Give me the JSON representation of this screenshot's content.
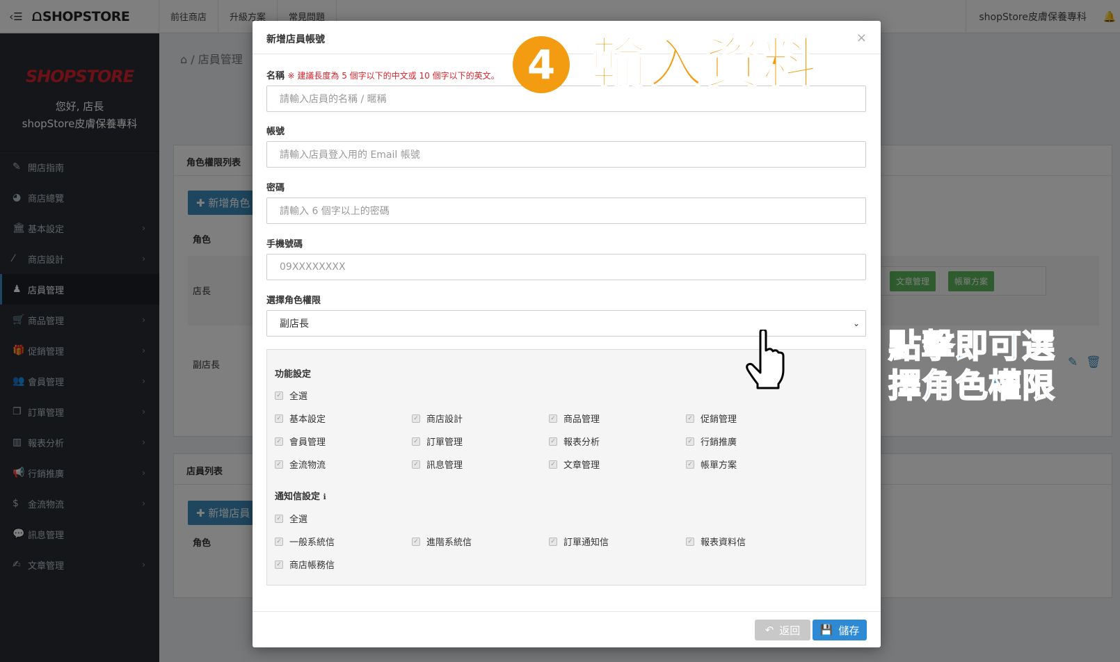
{
  "topbar": {
    "brand": "SHOPSTORE",
    "nav": [
      "前往商店",
      "升級方案",
      "常見問題"
    ],
    "store_name": "shopStore皮膚保養專科"
  },
  "sidebar": {
    "logo": "SHOPSTORE",
    "greeting": "您好, 店長",
    "store_name": "shopStore皮膚保養專科",
    "items": [
      {
        "label": "開店指南",
        "icon": "wrench-icon",
        "chevron": false
      },
      {
        "label": "商店總覽",
        "icon": "dashboard-icon",
        "chevron": false
      },
      {
        "label": "基本設定",
        "icon": "bank-icon",
        "chevron": true
      },
      {
        "label": "商店設計",
        "icon": "wand-icon",
        "chevron": true
      },
      {
        "label": "店員管理",
        "icon": "user-lock-icon",
        "chevron": false,
        "active": true
      },
      {
        "label": "商品管理",
        "icon": "cart-icon",
        "chevron": true
      },
      {
        "label": "促銷管理",
        "icon": "gift-icon",
        "chevron": true
      },
      {
        "label": "會員管理",
        "icon": "users-icon",
        "chevron": true
      },
      {
        "label": "訂單管理",
        "icon": "copy-icon",
        "chevron": true
      },
      {
        "label": "報表分析",
        "icon": "bar-chart-icon",
        "chevron": true
      },
      {
        "label": "行銷推廣",
        "icon": "bullhorn-icon",
        "chevron": true
      },
      {
        "label": "金流物流",
        "icon": "dollar-icon",
        "chevron": true
      },
      {
        "label": "訊息管理",
        "icon": "comments-icon",
        "chevron": false
      },
      {
        "label": "文章管理",
        "icon": "edit-icon",
        "chevron": true
      }
    ]
  },
  "background": {
    "breadcrumb": "店員管理",
    "roles_panel_title": "角色權限列表",
    "add_role_button": "新增角色",
    "role_col": "角色",
    "role_rows": [
      "店長",
      "副店長"
    ],
    "tags": [
      "文章管理",
      "帳單方案"
    ],
    "staff_panel_title": "店員列表",
    "add_staff_button": "新增店員",
    "staff_role_col": "角色"
  },
  "modal": {
    "title": "新增店員帳號",
    "close": "×",
    "name_label": "名稱",
    "name_hint": "※ 建議長度為 5 個字以下的中文或 10 個字以下的英文。",
    "name_placeholder": "請輸入店員的名稱 / 暱稱",
    "account_label": "帳號",
    "account_placeholder": "請輸入店員登入用的 Email 帳號",
    "password_label": "密碼",
    "password_placeholder": "請輸入 6 個字以上的密碼",
    "phone_label": "手機號碼",
    "phone_placeholder": "09XXXXXXXX",
    "role_label": "選擇角色權限",
    "role_selected": "副店長",
    "function_title": "功能設定",
    "function_select_all": "全選",
    "function_items": [
      "基本設定",
      "商店設計",
      "商品管理",
      "促銷管理",
      "會員管理",
      "訂單管理",
      "報表分析",
      "行銷推廣",
      "金流物流",
      "訊息管理",
      "文章管理",
      "帳單方案"
    ],
    "notify_title": "通知信設定",
    "notify_select_all": "全選",
    "notify_items": [
      "一般系統信",
      "進階系統信",
      "訂單通知信",
      "報表資料信",
      "商店帳務信"
    ],
    "back_button": "返回",
    "save_button": "儲存"
  },
  "annotations": {
    "step_number": "4",
    "step_title": "輸入資料",
    "tip_line1": "點擊即可選",
    "tip_line2": "擇角色權限"
  },
  "colors": {
    "primary": "#2f8ad6",
    "orange": "#f39c12",
    "sidebar_bg": "#2a2d33",
    "hint_red": "#d9232d",
    "tag_green": "#5cb85c"
  }
}
